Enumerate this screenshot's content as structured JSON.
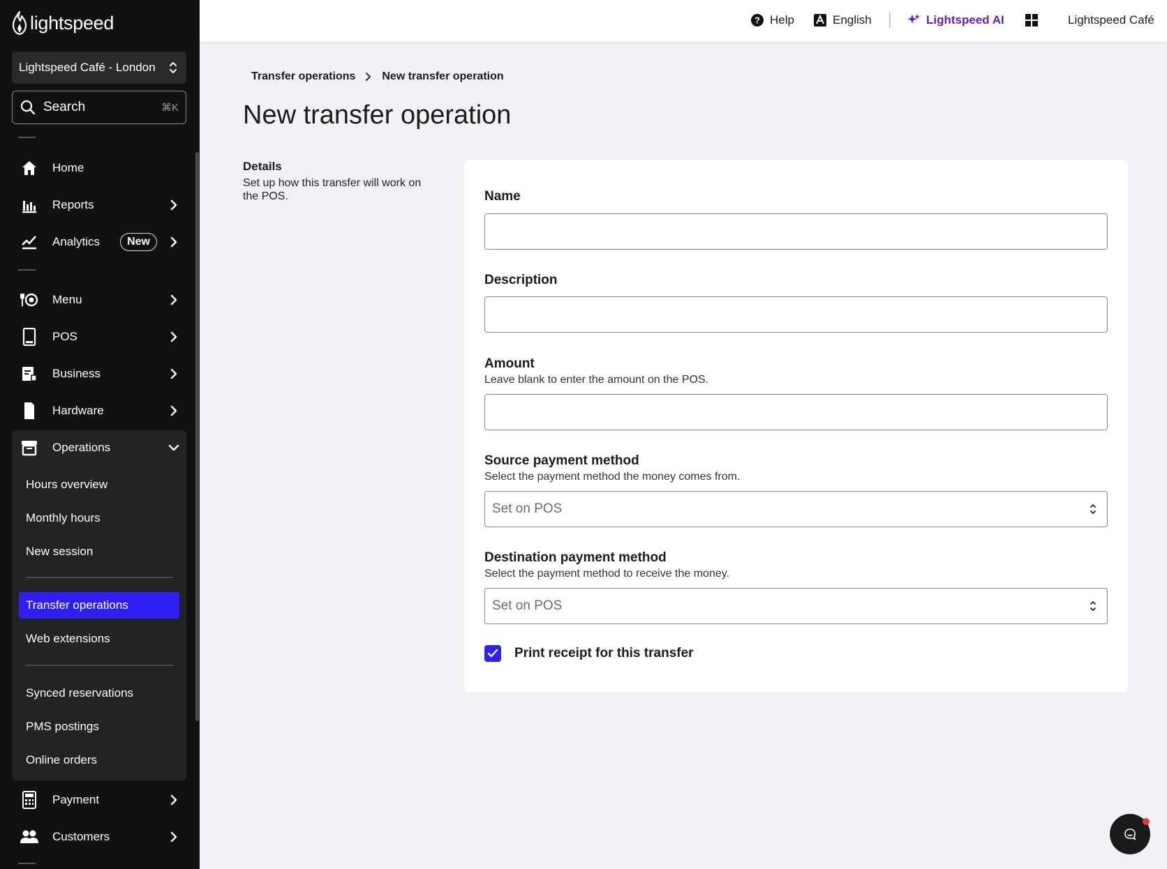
{
  "brand": {
    "logo_text": "lightspeed"
  },
  "sidebar": {
    "location": "Lightspeed Café - London",
    "search": {
      "label": "Search",
      "shortcut": "⌘K"
    },
    "items": [
      {
        "label": "Home"
      },
      {
        "label": "Reports"
      },
      {
        "label": "Analytics",
        "badge": "New"
      },
      {
        "label": "Menu"
      },
      {
        "label": "POS"
      },
      {
        "label": "Business"
      },
      {
        "label": "Hardware"
      },
      {
        "label": "Operations"
      },
      {
        "label": "Payment"
      },
      {
        "label": "Customers"
      }
    ],
    "operations_sub": [
      {
        "label": "Hours overview"
      },
      {
        "label": "Monthly hours"
      },
      {
        "label": "New session"
      },
      {
        "label": "Transfer operations",
        "active": true
      },
      {
        "label": "Web extensions"
      },
      {
        "label": "Synced reservations"
      },
      {
        "label": "PMS postings"
      },
      {
        "label": "Online orders"
      }
    ],
    "active_color": "#2f1ff5"
  },
  "topbar": {
    "help": "Help",
    "language": "English",
    "ai": "Lightspeed AI",
    "account": "Lightspeed Café"
  },
  "breadcrumb": {
    "parent": "Transfer operations",
    "current": "New transfer operation"
  },
  "page": {
    "title": "New transfer operation",
    "details_title": "Details",
    "details_desc": "Set up how this transfer will work on the POS."
  },
  "form": {
    "name": {
      "label": "Name",
      "value": ""
    },
    "description": {
      "label": "Description",
      "value": ""
    },
    "amount": {
      "label": "Amount",
      "help": "Leave blank to enter the amount on the POS.",
      "value": ""
    },
    "source": {
      "label": "Source payment method",
      "help": "Select the payment method the money comes from.",
      "value": "Set on POS"
    },
    "destination": {
      "label": "Destination payment method",
      "help": "Select the payment method to receive the money.",
      "value": "Set on POS"
    },
    "print_receipt": {
      "label": "Print receipt for this transfer",
      "checked": true
    }
  }
}
